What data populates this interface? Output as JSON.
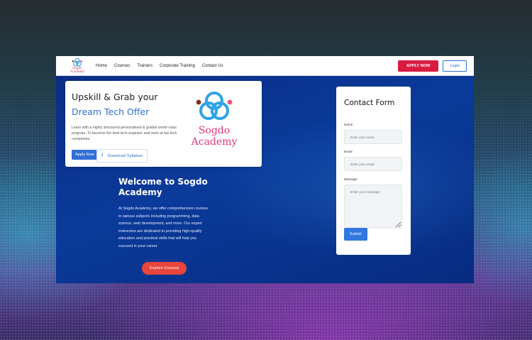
{
  "nav": {
    "brand": "Sogdo Academy",
    "links": [
      "Home",
      "Courses",
      "Trainers",
      "Corporate Training",
      "Contact Us"
    ],
    "apply_label": "APPLY NOW",
    "login_label": "Login"
  },
  "promo": {
    "title": "Upskill & Grab your",
    "subtitle": "Dream Tech Offer",
    "description": "Learn with a highly structured personalised & guided world-class program. To become the best tech engineer and work at top tech companies.",
    "apply_label": "Apply Now",
    "syllabus_label": "Download Syllabus",
    "logo_line1": "Sogdo",
    "logo_line2": "Academy"
  },
  "welcome": {
    "title": "Welcome to Sogdo Academy",
    "text": "At Sogdo Academy, we offer comprehensive courses in various subjects including programming, data science, web development, and more. Our expert instructors are dedicated to providing high-quality education and practical skills that will help you succeed in your career.",
    "button": "Explore Courses"
  },
  "contact": {
    "title": "Contact Form",
    "name_label": "Name",
    "name_placeholder": "Enter your name",
    "email_label": "Email",
    "email_placeholder": "Enter your email",
    "message_label": "Message",
    "message_placeholder": "Enter your message",
    "submit_label": "Submit"
  },
  "colors": {
    "brand_pink": "#e0337a",
    "accent_blue": "#2f6fd6",
    "apply_red": "#d91b42",
    "explore_red": "#e8453c",
    "hero_blue": "#0a3a9a"
  }
}
